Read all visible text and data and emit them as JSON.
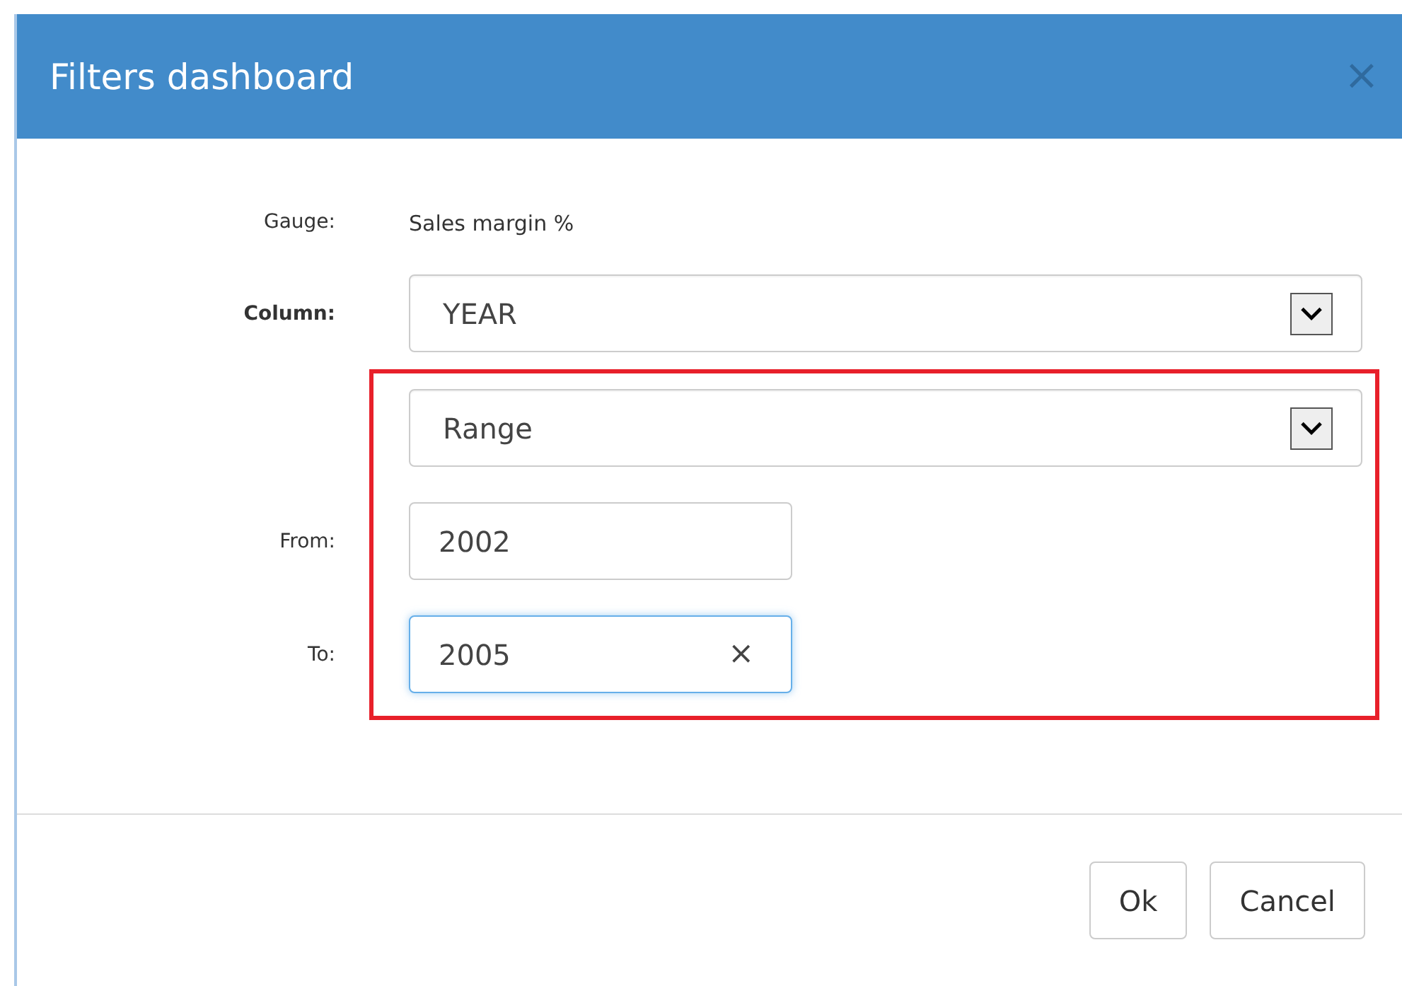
{
  "dialog": {
    "title": "Filters dashboard",
    "close": "×"
  },
  "fields": [
    {
      "label": "Gauge:",
      "kind": "text",
      "value": "Sales margin %",
      "bold": false
    },
    {
      "label": "Column:",
      "kind": "select",
      "value": "YEAR",
      "bold": true
    }
  ],
  "highlighted_group": {
    "fields": [
      {
        "kind": "select",
        "value": "Range"
      },
      {
        "label": "From:",
        "kind": "input",
        "value": "2002",
        "bold": false,
        "focused": false
      },
      {
        "label": "To:",
        "kind": "input",
        "value": "2005",
        "bold": false,
        "focused": true,
        "clear": "×"
      }
    ]
  },
  "buttons": [
    "Ok",
    "Cancel"
  ]
}
